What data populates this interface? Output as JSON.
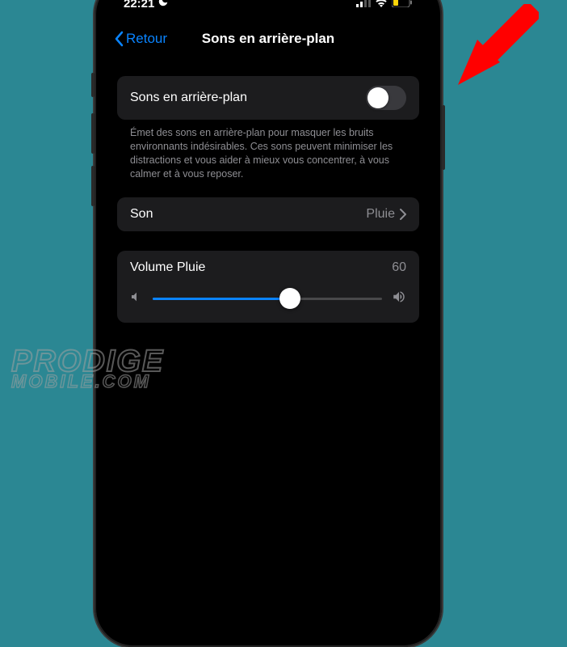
{
  "status": {
    "time": "22:21"
  },
  "nav": {
    "back": "Retour",
    "title": "Sons en arrière-plan"
  },
  "toggle": {
    "label": "Sons en arrière-plan"
  },
  "description": "Émet des sons en arrière-plan pour masquer les bruits environnants indésirables. Ces sons peuvent minimiser les distractions et vous aider à mieux vous concentrer, à vous calmer et à vous reposer.",
  "sound_row": {
    "label": "Son",
    "value": "Pluie"
  },
  "volume": {
    "label": "Volume Pluie",
    "value": "60"
  },
  "watermark": {
    "line1": "PRODIGE",
    "line2": "MOBILE.COM"
  }
}
